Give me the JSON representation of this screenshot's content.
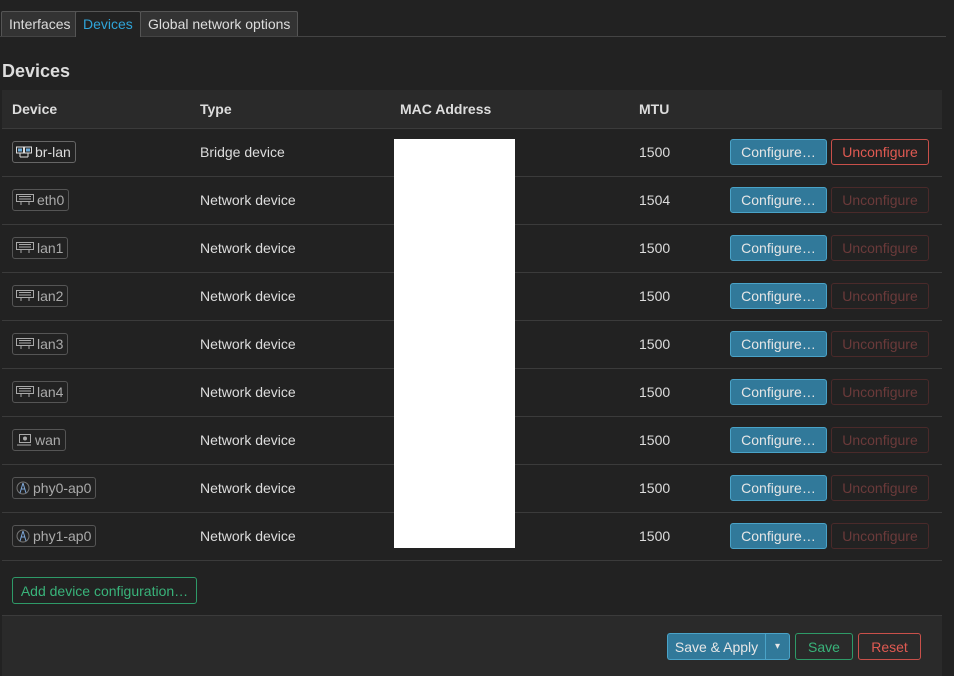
{
  "tabs": [
    {
      "label": "Interfaces",
      "active": false
    },
    {
      "label": "Devices",
      "active": true
    },
    {
      "label": "Global network options",
      "active": false
    }
  ],
  "page_title": "Devices",
  "table": {
    "headers": {
      "device": "Device",
      "type": "Type",
      "mac": "MAC Address",
      "mtu": "MTU"
    },
    "rows": [
      {
        "device": "br-lan",
        "icon": "bridge-icon",
        "type": "Bridge device",
        "mtu": "1500",
        "configure_label": "Configure…",
        "unconfigure_label": "Unconfigure",
        "unconfigure_enabled": true
      },
      {
        "device": "eth0",
        "icon": "ethernet-port-icon",
        "type": "Network device",
        "mtu": "1504",
        "configure_label": "Configure…",
        "unconfigure_label": "Unconfigure",
        "unconfigure_enabled": false
      },
      {
        "device": "lan1",
        "icon": "ethernet-port-icon",
        "type": "Network device",
        "mtu": "1500",
        "configure_label": "Configure…",
        "unconfigure_label": "Unconfigure",
        "unconfigure_enabled": false
      },
      {
        "device": "lan2",
        "icon": "ethernet-port-icon",
        "type": "Network device",
        "mtu": "1500",
        "configure_label": "Configure…",
        "unconfigure_label": "Unconfigure",
        "unconfigure_enabled": false
      },
      {
        "device": "lan3",
        "icon": "ethernet-port-icon",
        "type": "Network device",
        "mtu": "1500",
        "configure_label": "Configure…",
        "unconfigure_label": "Unconfigure",
        "unconfigure_enabled": false
      },
      {
        "device": "lan4",
        "icon": "ethernet-port-icon",
        "type": "Network device",
        "mtu": "1500",
        "configure_label": "Configure…",
        "unconfigure_label": "Unconfigure",
        "unconfigure_enabled": false
      },
      {
        "device": "wan",
        "icon": "wan-port-icon",
        "type": "Network device",
        "mtu": "1500",
        "configure_label": "Configure…",
        "unconfigure_label": "Unconfigure",
        "unconfigure_enabled": false
      },
      {
        "device": "phy0-ap0",
        "icon": "wireless-icon",
        "type": "Network device",
        "mtu": "1500",
        "configure_label": "Configure…",
        "unconfigure_label": "Unconfigure",
        "unconfigure_enabled": false
      },
      {
        "device": "phy1-ap0",
        "icon": "wireless-icon",
        "type": "Network device",
        "mtu": "1500",
        "configure_label": "Configure…",
        "unconfigure_label": "Unconfigure",
        "unconfigure_enabled": false
      }
    ]
  },
  "add_button": "Add device configuration…",
  "footer": {
    "save_apply": "Save & Apply",
    "dropdown_glyph": "▾",
    "save": "Save",
    "reset": "Reset"
  },
  "colors": {
    "background": "#222222",
    "accent_blue": "#31799a",
    "accent_green": "#39b37a",
    "accent_red": "#e05a52",
    "active_tab_text": "#2fa4d9"
  }
}
